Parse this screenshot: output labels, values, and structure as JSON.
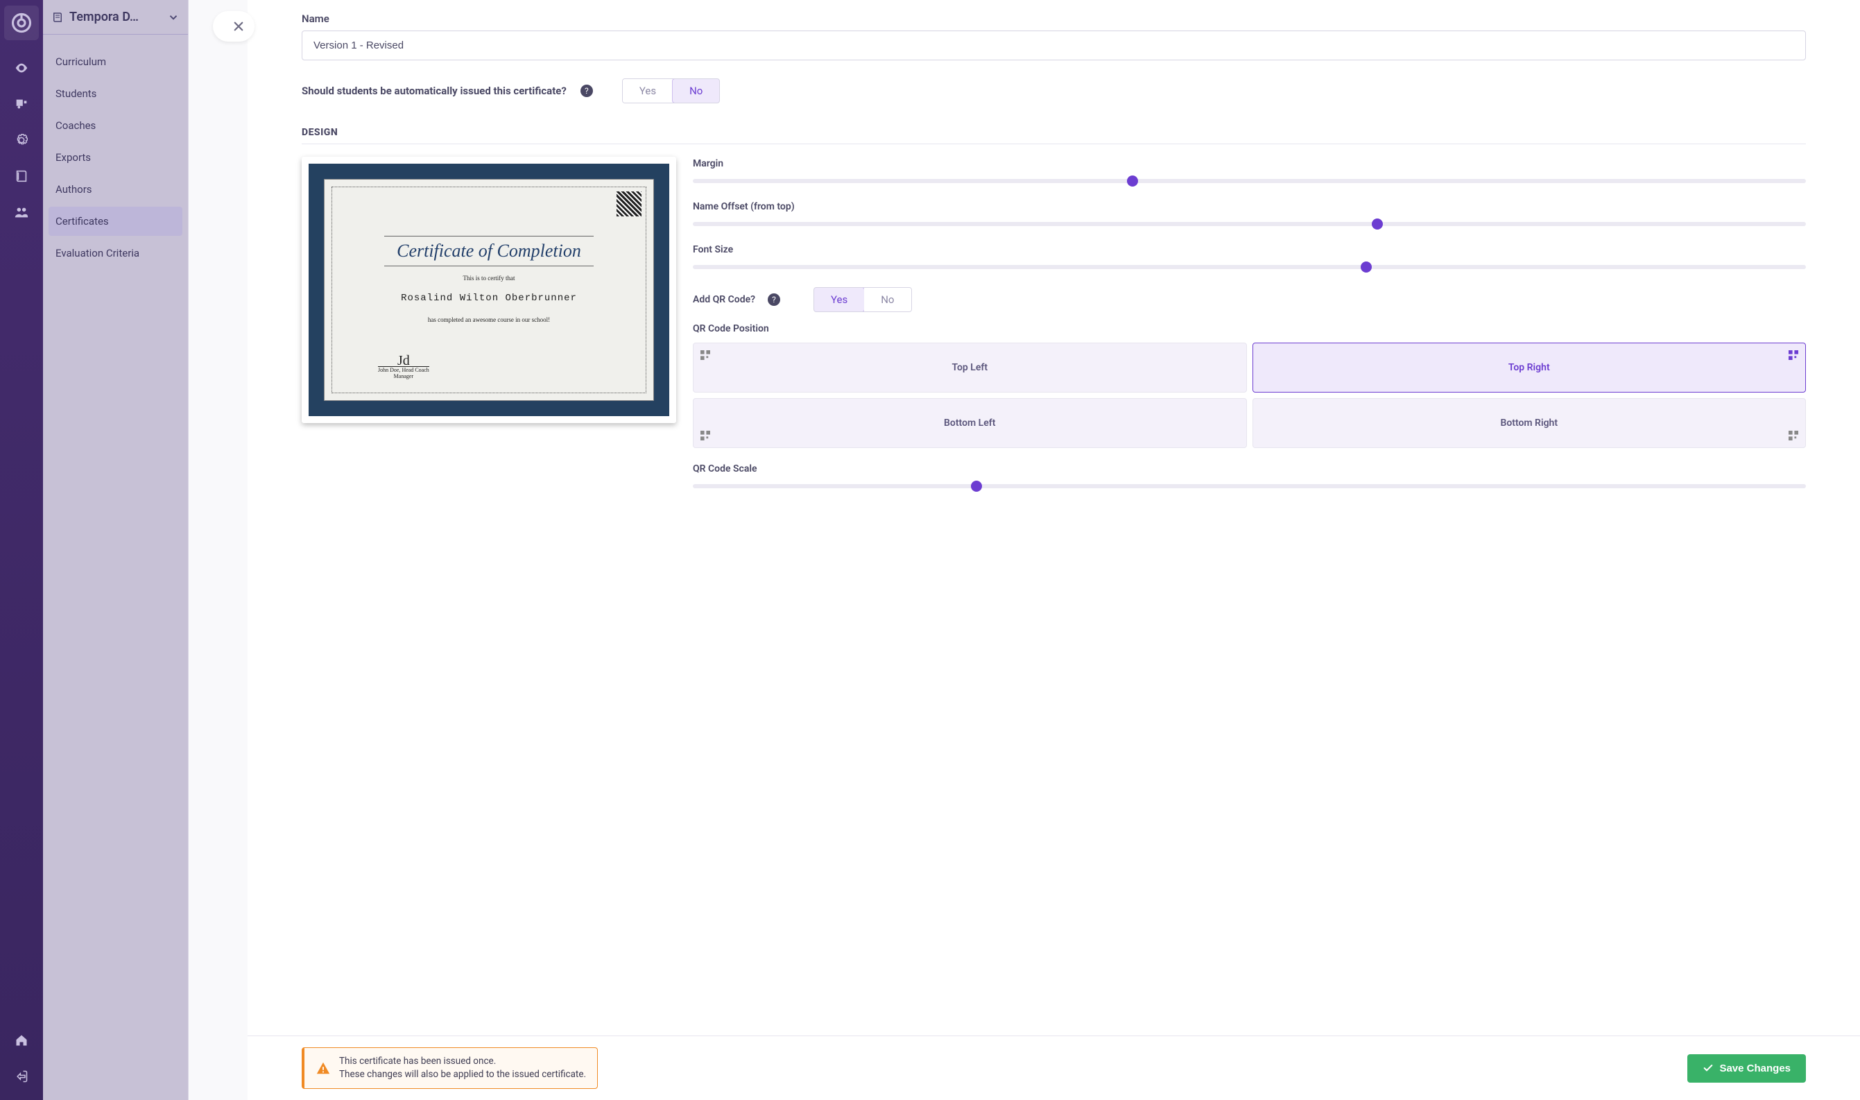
{
  "course_selector": {
    "label": "Tempora D…"
  },
  "sidebar": {
    "items": [
      {
        "label": "Curriculum"
      },
      {
        "label": "Students"
      },
      {
        "label": "Coaches"
      },
      {
        "label": "Exports"
      },
      {
        "label": "Authors"
      },
      {
        "label": "Certificates"
      },
      {
        "label": "Evaluation Criteria"
      }
    ],
    "active_index": 5
  },
  "form": {
    "name_label": "Name",
    "name_value": "Version 1 - Revised",
    "auto_issue_label": "Should students be automatically issued this certificate?",
    "yes": "Yes",
    "no": "No",
    "auto_issue_selected": "No",
    "design_header": "DESIGN",
    "controls": {
      "margin": "Margin",
      "name_offset": "Name Offset (from top)",
      "font_size": "Font Size",
      "add_qr": "Add QR Code?",
      "add_qr_selected": "Yes",
      "qr_position": "QR Code Position",
      "pos_tl": "Top Left",
      "pos_tr": "Top Right",
      "pos_bl": "Bottom Left",
      "pos_br": "Bottom Right",
      "qr_position_selected": "Top Right",
      "qr_scale": "QR Code Scale",
      "slider_margin_pct": 39,
      "slider_offset_pct": 61,
      "slider_font_pct": 60,
      "slider_scale_pct": 25
    }
  },
  "certificate_preview": {
    "title": "Certificate of Completion",
    "subtitle": "This is to certify that",
    "name": "Rosalind Wilton Oberbrunner",
    "footer": "has completed an awesome course in our school!",
    "sign_name": "John Doe, Head Coach",
    "sign_role": "Manager"
  },
  "alert": {
    "line1": "This certificate has been issued once.",
    "line2": "These changes will also be applied to the issued certificate."
  },
  "buttons": {
    "save": "Save Changes"
  }
}
